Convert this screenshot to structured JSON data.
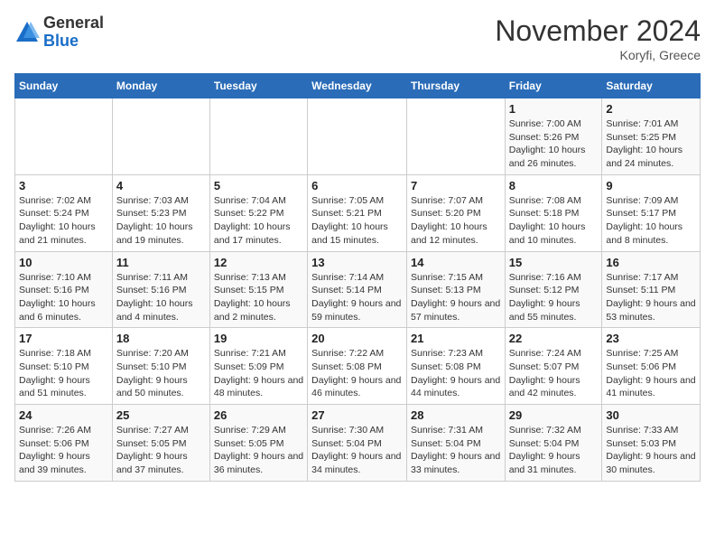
{
  "logo": {
    "general": "General",
    "blue": "Blue"
  },
  "title": "November 2024",
  "subtitle": "Koryfi, Greece",
  "weekdays": [
    "Sunday",
    "Monday",
    "Tuesday",
    "Wednesday",
    "Thursday",
    "Friday",
    "Saturday"
  ],
  "weeks": [
    [
      {
        "day": "",
        "info": ""
      },
      {
        "day": "",
        "info": ""
      },
      {
        "day": "",
        "info": ""
      },
      {
        "day": "",
        "info": ""
      },
      {
        "day": "",
        "info": ""
      },
      {
        "day": "1",
        "info": "Sunrise: 7:00 AM\nSunset: 5:26 PM\nDaylight: 10 hours and 26 minutes."
      },
      {
        "day": "2",
        "info": "Sunrise: 7:01 AM\nSunset: 5:25 PM\nDaylight: 10 hours and 24 minutes."
      }
    ],
    [
      {
        "day": "3",
        "info": "Sunrise: 7:02 AM\nSunset: 5:24 PM\nDaylight: 10 hours and 21 minutes."
      },
      {
        "day": "4",
        "info": "Sunrise: 7:03 AM\nSunset: 5:23 PM\nDaylight: 10 hours and 19 minutes."
      },
      {
        "day": "5",
        "info": "Sunrise: 7:04 AM\nSunset: 5:22 PM\nDaylight: 10 hours and 17 minutes."
      },
      {
        "day": "6",
        "info": "Sunrise: 7:05 AM\nSunset: 5:21 PM\nDaylight: 10 hours and 15 minutes."
      },
      {
        "day": "7",
        "info": "Sunrise: 7:07 AM\nSunset: 5:20 PM\nDaylight: 10 hours and 12 minutes."
      },
      {
        "day": "8",
        "info": "Sunrise: 7:08 AM\nSunset: 5:18 PM\nDaylight: 10 hours and 10 minutes."
      },
      {
        "day": "9",
        "info": "Sunrise: 7:09 AM\nSunset: 5:17 PM\nDaylight: 10 hours and 8 minutes."
      }
    ],
    [
      {
        "day": "10",
        "info": "Sunrise: 7:10 AM\nSunset: 5:16 PM\nDaylight: 10 hours and 6 minutes."
      },
      {
        "day": "11",
        "info": "Sunrise: 7:11 AM\nSunset: 5:16 PM\nDaylight: 10 hours and 4 minutes."
      },
      {
        "day": "12",
        "info": "Sunrise: 7:13 AM\nSunset: 5:15 PM\nDaylight: 10 hours and 2 minutes."
      },
      {
        "day": "13",
        "info": "Sunrise: 7:14 AM\nSunset: 5:14 PM\nDaylight: 9 hours and 59 minutes."
      },
      {
        "day": "14",
        "info": "Sunrise: 7:15 AM\nSunset: 5:13 PM\nDaylight: 9 hours and 57 minutes."
      },
      {
        "day": "15",
        "info": "Sunrise: 7:16 AM\nSunset: 5:12 PM\nDaylight: 9 hours and 55 minutes."
      },
      {
        "day": "16",
        "info": "Sunrise: 7:17 AM\nSunset: 5:11 PM\nDaylight: 9 hours and 53 minutes."
      }
    ],
    [
      {
        "day": "17",
        "info": "Sunrise: 7:18 AM\nSunset: 5:10 PM\nDaylight: 9 hours and 51 minutes."
      },
      {
        "day": "18",
        "info": "Sunrise: 7:20 AM\nSunset: 5:10 PM\nDaylight: 9 hours and 50 minutes."
      },
      {
        "day": "19",
        "info": "Sunrise: 7:21 AM\nSunset: 5:09 PM\nDaylight: 9 hours and 48 minutes."
      },
      {
        "day": "20",
        "info": "Sunrise: 7:22 AM\nSunset: 5:08 PM\nDaylight: 9 hours and 46 minutes."
      },
      {
        "day": "21",
        "info": "Sunrise: 7:23 AM\nSunset: 5:08 PM\nDaylight: 9 hours and 44 minutes."
      },
      {
        "day": "22",
        "info": "Sunrise: 7:24 AM\nSunset: 5:07 PM\nDaylight: 9 hours and 42 minutes."
      },
      {
        "day": "23",
        "info": "Sunrise: 7:25 AM\nSunset: 5:06 PM\nDaylight: 9 hours and 41 minutes."
      }
    ],
    [
      {
        "day": "24",
        "info": "Sunrise: 7:26 AM\nSunset: 5:06 PM\nDaylight: 9 hours and 39 minutes."
      },
      {
        "day": "25",
        "info": "Sunrise: 7:27 AM\nSunset: 5:05 PM\nDaylight: 9 hours and 37 minutes."
      },
      {
        "day": "26",
        "info": "Sunrise: 7:29 AM\nSunset: 5:05 PM\nDaylight: 9 hours and 36 minutes."
      },
      {
        "day": "27",
        "info": "Sunrise: 7:30 AM\nSunset: 5:04 PM\nDaylight: 9 hours and 34 minutes."
      },
      {
        "day": "28",
        "info": "Sunrise: 7:31 AM\nSunset: 5:04 PM\nDaylight: 9 hours and 33 minutes."
      },
      {
        "day": "29",
        "info": "Sunrise: 7:32 AM\nSunset: 5:04 PM\nDaylight: 9 hours and 31 minutes."
      },
      {
        "day": "30",
        "info": "Sunrise: 7:33 AM\nSunset: 5:03 PM\nDaylight: 9 hours and 30 minutes."
      }
    ]
  ]
}
